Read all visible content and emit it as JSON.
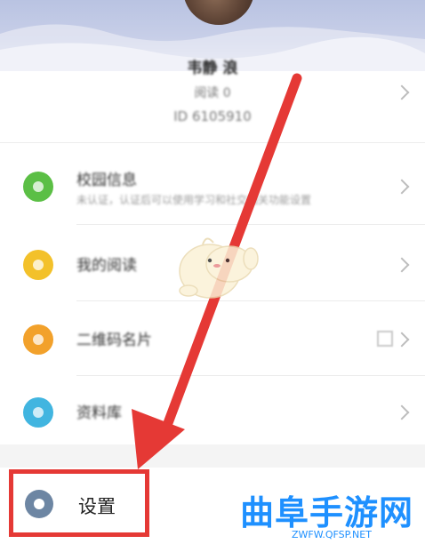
{
  "profile": {
    "name": "韦静 浪",
    "sub": "阅读 0",
    "id": "ID 6105910"
  },
  "menu": [
    {
      "title": "校园信息",
      "subtitle": "未认证，认证后可以使用学习和社交相关功能设置",
      "color": "#5bbf45"
    },
    {
      "title": "我的阅读",
      "subtitle": "",
      "color": "#f3c12a"
    },
    {
      "title": "二维码名片",
      "subtitle": "",
      "color": "#f2a12b"
    },
    {
      "title": "资料库",
      "subtitle": "",
      "color": "#41b5e0"
    }
  ],
  "settings": {
    "label": "设置",
    "icon": "gear-icon",
    "color": "#6d86a3"
  },
  "annotation": {
    "arrow_color": "#e53935",
    "box_color": "#e53935"
  },
  "watermark": {
    "title": "曲阜手游网",
    "url": "ZWFW.QFSP.NET",
    "color": "#1e90ff"
  }
}
